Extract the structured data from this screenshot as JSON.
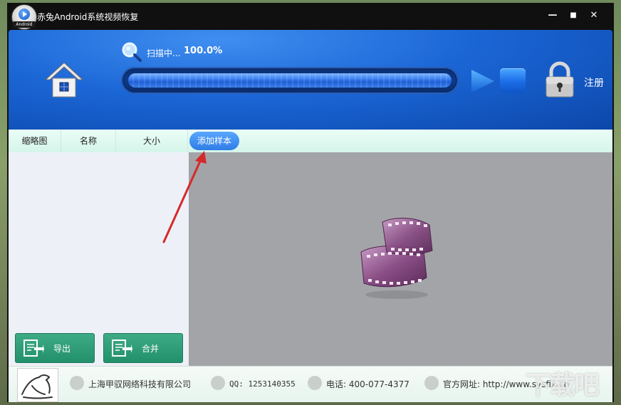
{
  "window": {
    "title": "赤兔Android系统视频恢复",
    "logo_tag": "Android",
    "minimize": "—",
    "maximize": "■",
    "close": "✕"
  },
  "header": {
    "scan_label": "扫描中...",
    "scan_percent": "100.0%",
    "progress_value": 1.0,
    "register_label": "注册"
  },
  "columns": {
    "thumbnail": "缩略图",
    "name": "名称",
    "size": "大小",
    "add_sample": "添加样本"
  },
  "actions": {
    "export_label": "导出",
    "merge_label": "合并"
  },
  "footer": {
    "company": "上海甲驭网络科技有限公司",
    "qq": "QQ: 1253140355",
    "phone": "电话: 400-077-4377",
    "website": "官方网址: http://www.sysfix.cn"
  },
  "watermark": "下载吧",
  "colors": {
    "header_blue": "#1b66d6",
    "action_green": "#23906c",
    "add_sample_blue": "#2e7de6",
    "preview_gray": "#a3a4a8",
    "arrow_red": "#d42a2a"
  }
}
